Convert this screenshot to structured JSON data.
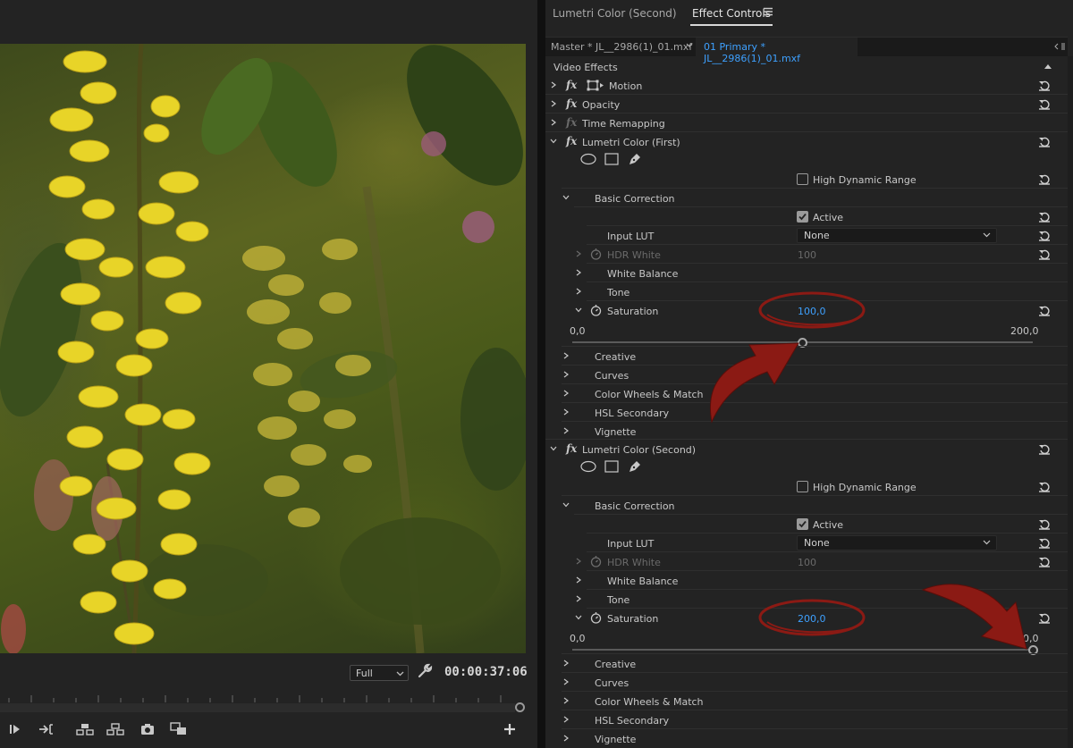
{
  "monitor": {
    "resolution": "Full",
    "timecode": "00:00:37:06",
    "icons": [
      "wrench-icon",
      "step-forward-icon",
      "go-to-out-icon",
      "lift-icon",
      "extract-icon",
      "camera-icon",
      "compare-view-icon",
      "add-button-icon"
    ]
  },
  "tabs": {
    "lumetri": "Lumetri Color (Second)",
    "effect_controls": "Effect Controls"
  },
  "clip": {
    "master": "Master * JL__2986(1)_01.mxf",
    "active": "01 Primary * JL__2986(1)_01.mxf"
  },
  "header": {
    "video_effects": "Video Effects"
  },
  "effects": {
    "motion": "Motion",
    "opacity": "Opacity",
    "time_remapping": "Time Remapping"
  },
  "lumetri1": {
    "title": "Lumetri Color (First)",
    "hdr": "High Dynamic Range",
    "basic": "Basic Correction",
    "active": "Active",
    "input_lut": "Input LUT",
    "lut_value": "None",
    "hdr_white": "HDR White",
    "hdr_white_value": "100",
    "white_balance": "White Balance",
    "tone": "Tone",
    "saturation": "Saturation",
    "saturation_value": "100,0",
    "scale_min": "0,0",
    "scale_max": "200,0",
    "saturation_level": 100,
    "sections": [
      "Creative",
      "Curves",
      "Color Wheels & Match",
      "HSL Secondary",
      "Vignette"
    ]
  },
  "lumetri2": {
    "title": "Lumetri Color (Second)",
    "hdr": "High Dynamic Range",
    "basic": "Basic Correction",
    "active": "Active",
    "input_lut": "Input LUT",
    "lut_value": "None",
    "hdr_white": "HDR White",
    "hdr_white_value": "100",
    "white_balance": "White Balance",
    "tone": "Tone",
    "saturation": "Saturation",
    "saturation_value": "200,0",
    "scale_min": "0,0",
    "scale_max": "200,0",
    "saturation_level": 200,
    "sections": [
      "Creative",
      "Curves",
      "Color Wheels & Match",
      "HSL Secondary",
      "Vignette"
    ]
  },
  "colors": {
    "accent_blue": "#3ea1ff",
    "annotation_red": "#8b1a14",
    "panel_bg": "#232323"
  }
}
